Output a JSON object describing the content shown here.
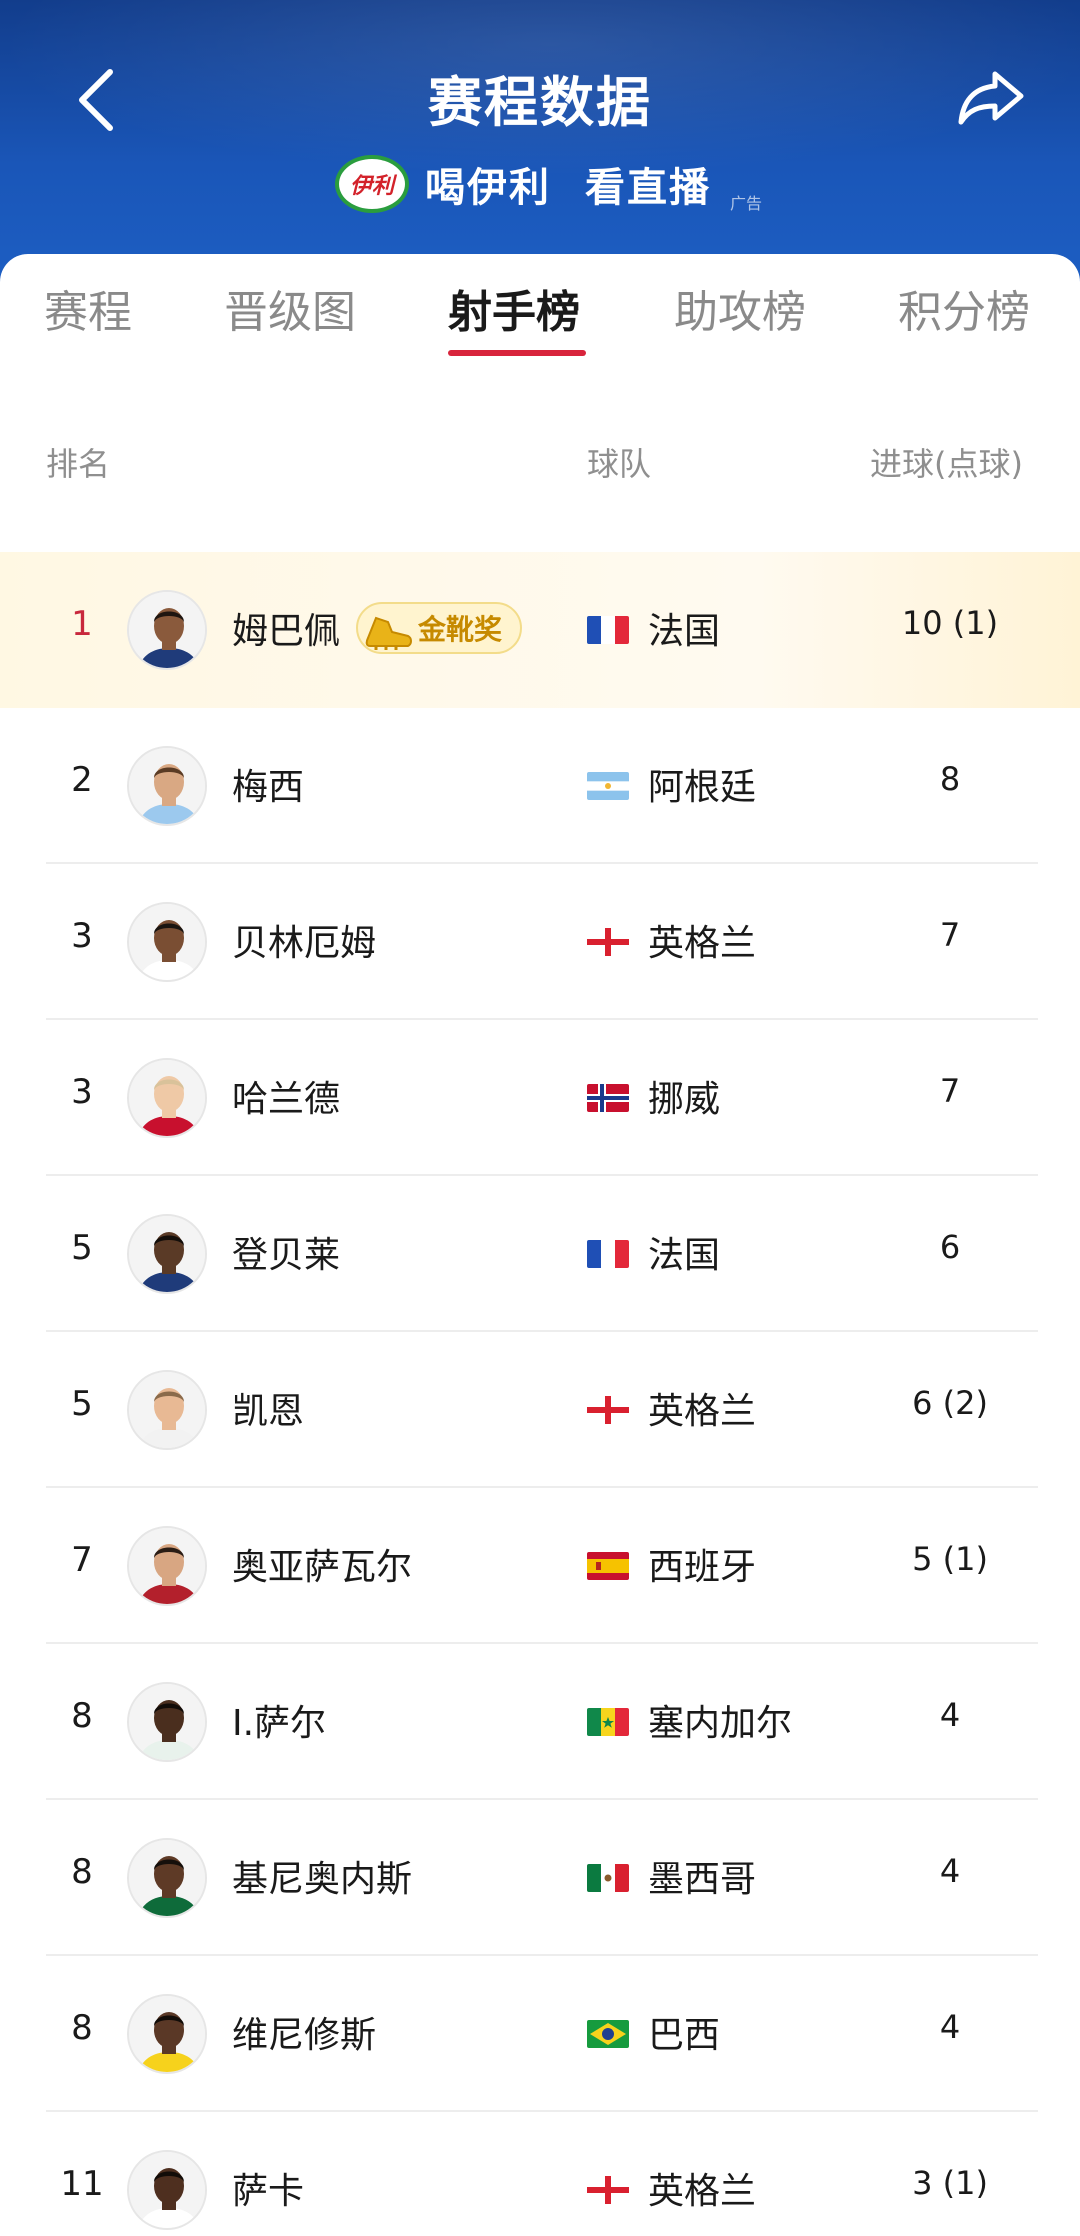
{
  "header": {
    "title": "赛程数据",
    "ad_logo": "伊利",
    "ad_text_1": "喝伊利",
    "ad_text_2": "看直播",
    "ad_tag": "广告"
  },
  "tabs": [
    "赛程",
    "晋级图",
    "射手榜",
    "助攻榜",
    "积分榜"
  ],
  "active_tab": "射手榜",
  "columns": {
    "rank": "排名",
    "team": "球队",
    "goals": "进球(点球)"
  },
  "badge": "金靴奖",
  "colors": {
    "header": "#1a56b8",
    "accent": "#d8243c",
    "gold": "#c68a00"
  },
  "rows": [
    {
      "rank": "1",
      "name": "姆巴佩",
      "team": "法国",
      "goals": "10 (1)",
      "flag": "france",
      "badge": true
    },
    {
      "rank": "2",
      "name": "梅西",
      "team": "阿根廷",
      "goals": "8",
      "flag": "argentina"
    },
    {
      "rank": "3",
      "name": "贝林厄姆",
      "team": "英格兰",
      "goals": "7",
      "flag": "england"
    },
    {
      "rank": "3",
      "name": "哈兰德",
      "team": "挪威",
      "goals": "7",
      "flag": "norway"
    },
    {
      "rank": "5",
      "name": "登贝莱",
      "team": "法国",
      "goals": "6",
      "flag": "france"
    },
    {
      "rank": "5",
      "name": "凯恩",
      "team": "英格兰",
      "goals": "6 (2)",
      "flag": "england"
    },
    {
      "rank": "7",
      "name": "奥亚萨瓦尔",
      "team": "西班牙",
      "goals": "5 (1)",
      "flag": "spain"
    },
    {
      "rank": "8",
      "name": "I.萨尔",
      "team": "塞内加尔",
      "goals": "4",
      "flag": "senegal"
    },
    {
      "rank": "8",
      "name": "基尼奥内斯",
      "team": "墨西哥",
      "goals": "4",
      "flag": "mexico"
    },
    {
      "rank": "8",
      "name": "维尼修斯",
      "team": "巴西",
      "goals": "4",
      "flag": "brazil"
    },
    {
      "rank": "11",
      "name": "萨卡",
      "team": "英格兰",
      "goals": "3 (1)",
      "flag": "england"
    }
  ]
}
